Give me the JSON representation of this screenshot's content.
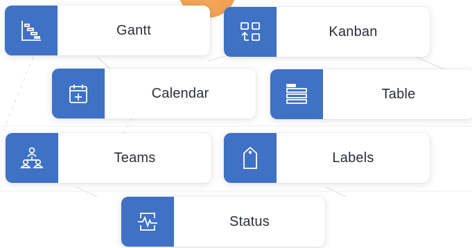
{
  "theme": {
    "accent": "#3f71c5",
    "blob": "#f0a154",
    "text": "#2b2f36"
  },
  "cards": {
    "gantt": {
      "label": "Gantt",
      "icon": "gantt-chart-icon"
    },
    "kanban": {
      "label": "Kanban",
      "icon": "kanban-board-icon"
    },
    "calendar": {
      "label": "Calendar",
      "icon": "calendar-add-icon"
    },
    "table": {
      "label": "Table",
      "icon": "table-rows-icon"
    },
    "teams": {
      "label": "Teams",
      "icon": "team-hierarchy-icon"
    },
    "labels": {
      "label": "Labels",
      "icon": "tag-icon"
    },
    "status": {
      "label": "Status",
      "icon": "status-pulse-icon"
    }
  }
}
